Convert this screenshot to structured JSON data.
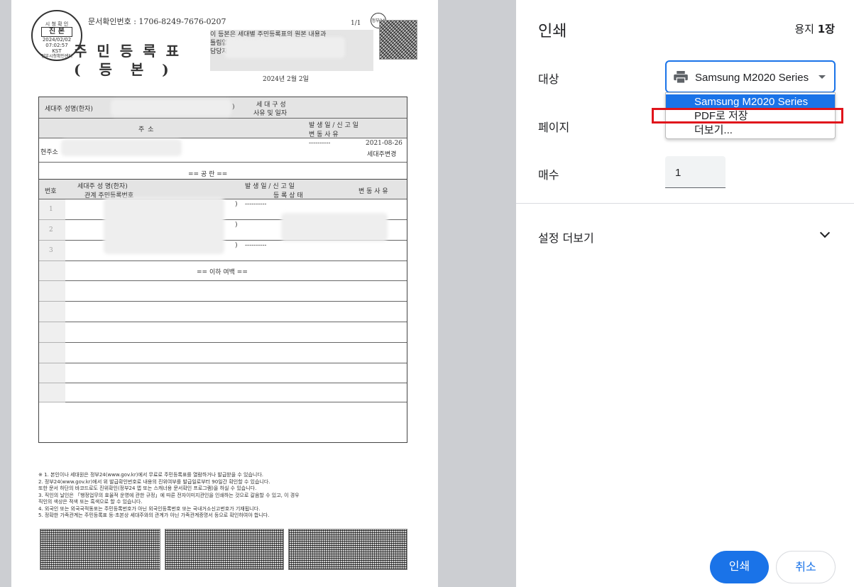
{
  "preview": {
    "seal": {
      "top": "시 청 확 인",
      "main": "진 본",
      "date": "2024/02/02",
      "time": "07:02:57",
      "tz": "KST",
      "bottom": "정부시청확인센터"
    },
    "gov_badge": "정부24",
    "doc_number": "문서확인번호 : 1706-8249-7676-0207",
    "page_number": "1/1",
    "title": "주민등록표",
    "subtitle": "(등본)",
    "cert_line1": "이 등본은 세대별 주민등록표의 원본 내용과",
    "cert_line2": "틀림없음을 증명합니다.",
    "cert_line3": "담당자:",
    "issue_date": "2024년 2월 2일",
    "table": {
      "householder_label": "세대주 성명(한자)",
      "household_reason_label1": "세 대 구 성",
      "household_reason_label2": "사유 및 일자",
      "address_label": "주          소",
      "report_date_label1": "발 생 일  /  신 고 일",
      "report_date_label2": "변       동       사       유",
      "current_label": "현주소",
      "dashes": "----------",
      "change_date": "2021-08-26",
      "change_reason": "세대주변경",
      "blank_label": "==  공    란  ==",
      "col_no": "번호",
      "col_name1": "세대주    성  명(한자)",
      "col_name2": "관계     주민등록번호",
      "col_date1": "발 생 일  /  신 고 일",
      "col_date2": "등 록 상 태",
      "col_reason": "변 동 사 유",
      "rows": [
        "1",
        "2",
        "3"
      ],
      "row_paren": ")",
      "end_label": "== 이하 여백 =="
    },
    "notes": [
      "※ 1. 본인이나 세대원은 정부24(www.gov.kr)에서 무료로 주민등록표를 열람하거나 발급받을 수 있습니다.",
      "   2. 정부24(www.gov.kr)에서 위 발급확인번호로 내용의 진위여부를 발급일로부터 90일간 확인할 수 있습니다.",
      "      또한 문서 하단의 바코드로도 진위확인(정부24 앱 또는 스캐너용 문서확인 프로그램)을 하실 수 있습니다.",
      "   3. 직인의 날인은 「행정업무의 효율적 운영에 관한 규정」에 따른 전자이미지관인을 인쇄하는 것으로 갈음할 수 있고, 이 경우",
      "      직인의 색상은 적색 또는 흑색으로 할 수 있습니다.",
      "   4. 외국인 또는 외국국적동포는 주민등록번호가 아닌 외국인등록번호 또는 국내거소신고번호가 기재됩니다.",
      "   5. 정확한 가족관계는 주민등록표 등·초본상 세대주와의 관계가 아닌 가족관계증명서 등으로 확인하여야 합니다."
    ]
  },
  "panel": {
    "title": "인쇄",
    "sheets_prefix": "용지 ",
    "sheets_value": "1장",
    "destination_label": "대상",
    "destination_value": "Samsung M2020 Series",
    "destination_options": [
      "Samsung M2020 Series",
      "PDF로 저장",
      "더보기..."
    ],
    "pages_label": "페이지",
    "copies_label": "매수",
    "copies_value": "1",
    "more_settings": "설정 더보기",
    "print_button": "인쇄",
    "cancel_button": "취소",
    "highlight_color": "#e0141b",
    "accent_color": "#1a73e8",
    "printer_icon": "printer-icon",
    "chevron_icon": "chevron-down-icon"
  }
}
